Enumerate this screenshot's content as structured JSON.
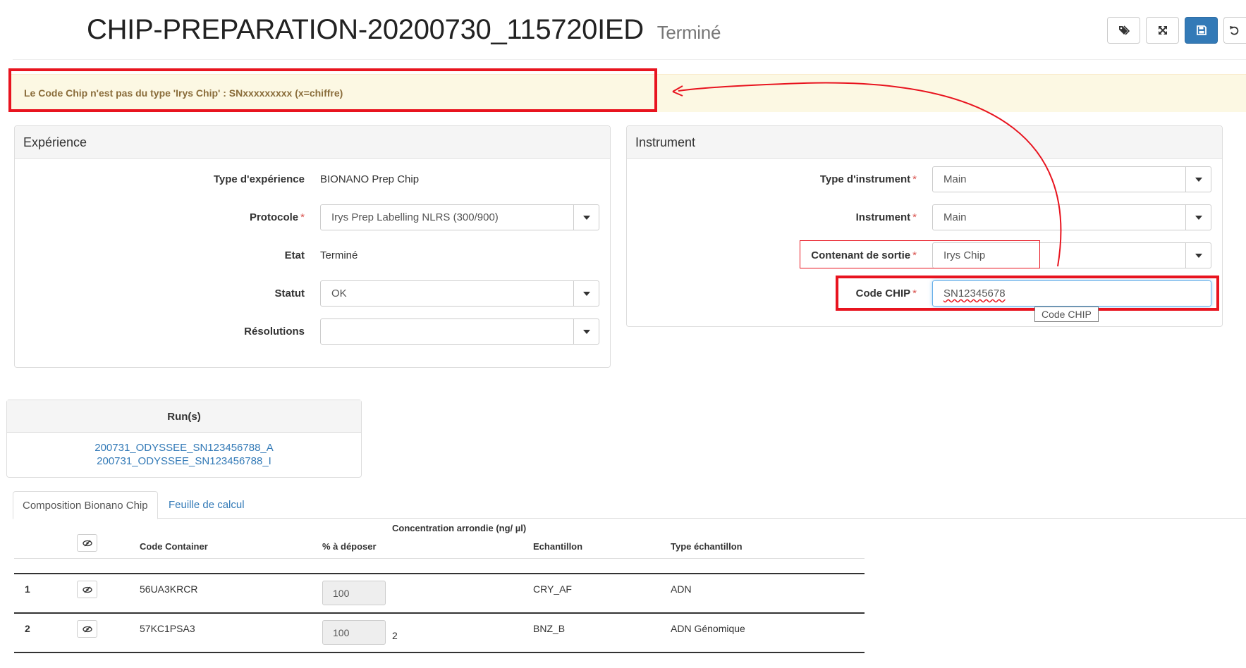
{
  "header": {
    "title": "CHIP-PREPARATION-20200730_115720IED",
    "state": "Terminé",
    "toolbar": [
      {
        "icon": "tags-icon"
      },
      {
        "icon": "fullscreen-icon"
      },
      {
        "icon": "save-icon"
      },
      {
        "icon": "undo-icon"
      }
    ]
  },
  "alert": {
    "message": "Le Code Chip n'est pas du type 'Irys Chip' : SNxxxxxxxxx (x=chiffre)"
  },
  "experience": {
    "heading": "Expérience",
    "type_label": "Type d'expérience",
    "type_value": "BIONANO Prep Chip",
    "protocol_label": "Protocole",
    "protocol_value": "Irys Prep Labelling NLRS (300/900)",
    "state_label": "Etat",
    "state_value": "Terminé",
    "status_label": "Statut",
    "status_value": "OK",
    "resolutions_label": "Résolutions",
    "resolutions_value": ""
  },
  "instrument": {
    "heading": "Instrument",
    "type_label": "Type d'instrument",
    "type_value": "Main",
    "instrument_label": "Instrument",
    "instrument_value": "Main",
    "container_label": "Contenant de sortie",
    "container_value": "Irys Chip",
    "chip_label": "Code CHIP",
    "chip_value": "SN12345678",
    "chip_tooltip": "Code CHIP"
  },
  "required_mark": "*",
  "runs": {
    "heading": "Run(s)",
    "links": [
      "200731_ODYSSEE_SN123456788_A",
      "200731_ODYSSEE_SN123456788_I"
    ]
  },
  "tabs": [
    {
      "label": "Composition Bionano Chip",
      "active": true
    },
    {
      "label": "Feuille de calcul",
      "active": false
    }
  ],
  "table": {
    "headers": {
      "code": "Code Container",
      "percent": "% à déposer",
      "concentration": "Concentration arrondie (ng/ µl)",
      "sample": "Echantillon",
      "sample_type": "Type échantillon"
    },
    "rows": [
      {
        "index": "1",
        "code": "56UA3KRCR",
        "percent": "100",
        "concentration": "",
        "sample": "CRY_AF",
        "sample_type": "ADN"
      },
      {
        "index": "2",
        "code": "57KC1PSA3",
        "percent": "100",
        "concentration": "2",
        "sample": "BNZ_B",
        "sample_type": "ADN Génomique"
      }
    ]
  },
  "colors": {
    "annotation": "#e8141f",
    "alert_bg": "#fcf8e3",
    "alert_text": "#8a6d3b",
    "link": "#337ab7",
    "primary": "#337ab7"
  }
}
